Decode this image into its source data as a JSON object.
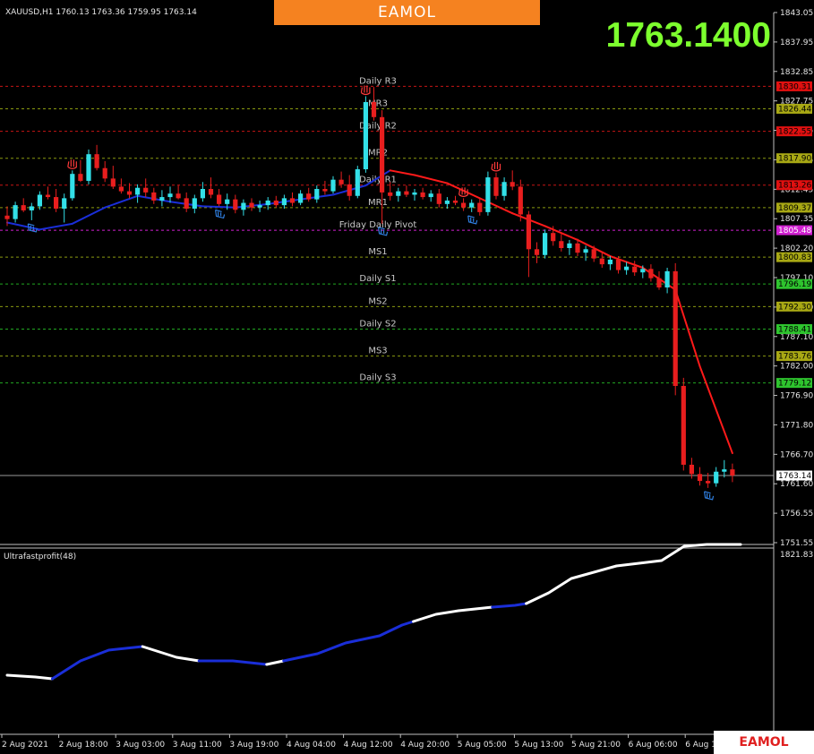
{
  "header": {
    "symbol_line": "XAUUSD,H1  1760.13 1763.36 1759.95 1763.14",
    "big_price": "1763.1400",
    "banner_brand": "EAMOL"
  },
  "footer": {
    "watermark": "EAMOL"
  },
  "indicator": {
    "label": "Ultrafastprofit(48)"
  },
  "colors": {
    "background": "#000000",
    "bull_candle": "#33e0e8",
    "bear_candle": "#e81e1e",
    "ma_up": "#1a2ed8",
    "ma_down": "#ff1a1a",
    "pivot": "#d020d0",
    "resist_tag": "#e01010",
    "mid_tag": "#a8a814",
    "support_tag": "#2ec42e",
    "big_price": "#7dff2e",
    "banner": "#f58220"
  },
  "chart_data": [
    {
      "type": "candlestick",
      "title": "XAUUSD,H1",
      "ylim": [
        1751.55,
        1843.05
      ],
      "y_ticks": [
        "1843.05",
        "1837.95",
        "1832.85",
        "1827.75",
        "1822.65",
        "1817.55",
        "1812.45",
        "1807.35",
        "1802.20",
        "1797.10",
        "1792.00",
        "1787.10",
        "1782.00",
        "1776.90",
        "1771.80",
        "1766.70",
        "1761.60",
        "1756.55",
        "1751.55"
      ],
      "x_ticks": [
        "2 Aug 2021",
        "2 Aug 18:00",
        "3 Aug 03:00",
        "3 Aug 11:00",
        "3 Aug 19:00",
        "4 Aug 04:00",
        "4 Aug 12:00",
        "4 Aug 20:00",
        "5 Aug 05:00",
        "5 Aug 13:00",
        "5 Aug 21:00",
        "6 Aug 06:00",
        "6 Aug 14:00"
      ],
      "current_price": 1763.14,
      "current_price_label": "1763.14",
      "levels": [
        {
          "name": "Daily R3",
          "price": 1830.31,
          "tag": "1830.31",
          "kind": "resist"
        },
        {
          "name": "MR3",
          "price": 1826.44,
          "tag": "1826.44",
          "kind": "mid"
        },
        {
          "name": "Daily R2",
          "price": 1822.55,
          "tag": "1822.55",
          "kind": "resist"
        },
        {
          "name": "MR2",
          "price": 1817.9,
          "tag": "1817.90",
          "kind": "mid"
        },
        {
          "name": "Daily R1",
          "price": 1813.26,
          "tag": "1813.26",
          "kind": "resist"
        },
        {
          "name": "MR1",
          "price": 1809.37,
          "tag": "1809.37",
          "kind": "mid"
        },
        {
          "name": "Friday  Daily Pivot",
          "price": 1805.48,
          "tag": "1805.48",
          "kind": "pivot"
        },
        {
          "name": "MS1",
          "price": 1800.83,
          "tag": "1800.83",
          "kind": "mid"
        },
        {
          "name": "Daily S1",
          "price": 1796.19,
          "tag": "1796.19",
          "kind": "support"
        },
        {
          "name": "MS2",
          "price": 1792.3,
          "tag": "1792.30",
          "kind": "mid"
        },
        {
          "name": "Daily S2",
          "price": 1788.41,
          "tag": "1788.41",
          "kind": "support"
        },
        {
          "name": "MS3",
          "price": 1783.76,
          "tag": "1783.76",
          "kind": "mid"
        },
        {
          "name": "Daily S3",
          "price": 1779.12,
          "tag": "1779.12",
          "kind": "support"
        }
      ],
      "candles": [
        [
          1808.0,
          1809.6,
          1806.2,
          1807.4
        ],
        [
          1807.4,
          1810.4,
          1806.8,
          1809.8
        ],
        [
          1809.8,
          1811.0,
          1808.6,
          1808.9
        ],
        [
          1808.9,
          1810.2,
          1807.2,
          1809.6
        ],
        [
          1809.6,
          1812.2,
          1809.0,
          1811.6
        ],
        [
          1811.6,
          1813.0,
          1810.8,
          1811.2
        ],
        [
          1811.2,
          1812.6,
          1808.6,
          1809.2
        ],
        [
          1809.2,
          1811.8,
          1806.8,
          1811.0
        ],
        [
          1811.0,
          1815.8,
          1810.6,
          1815.2
        ],
        [
          1815.2,
          1817.6,
          1813.8,
          1814.0
        ],
        [
          1814.0,
          1819.4,
          1813.4,
          1818.6
        ],
        [
          1818.6,
          1820.2,
          1815.8,
          1816.2
        ],
        [
          1816.2,
          1817.4,
          1813.8,
          1814.4
        ],
        [
          1814.4,
          1816.6,
          1812.6,
          1813.0
        ],
        [
          1813.0,
          1814.4,
          1811.8,
          1812.2
        ],
        [
          1812.2,
          1813.6,
          1811.0,
          1811.6
        ],
        [
          1811.6,
          1813.4,
          1810.2,
          1812.8
        ],
        [
          1812.8,
          1814.4,
          1811.2,
          1812.0
        ],
        [
          1812.0,
          1812.8,
          1810.0,
          1810.6
        ],
        [
          1810.6,
          1812.4,
          1809.6,
          1811.2
        ],
        [
          1811.2,
          1813.0,
          1810.2,
          1811.8
        ],
        [
          1811.8,
          1813.2,
          1810.8,
          1811.0
        ],
        [
          1811.0,
          1812.0,
          1808.6,
          1809.2
        ],
        [
          1809.2,
          1811.6,
          1808.4,
          1811.0
        ],
        [
          1811.0,
          1813.8,
          1810.4,
          1812.6
        ],
        [
          1812.6,
          1814.6,
          1811.0,
          1811.6
        ],
        [
          1811.6,
          1812.6,
          1809.6,
          1810.0
        ],
        [
          1810.0,
          1811.8,
          1809.0,
          1810.8
        ],
        [
          1810.8,
          1811.6,
          1808.4,
          1809.0
        ],
        [
          1809.0,
          1810.8,
          1808.0,
          1810.2
        ],
        [
          1810.2,
          1811.0,
          1808.8,
          1809.4
        ],
        [
          1809.4,
          1810.6,
          1808.6,
          1809.8
        ],
        [
          1809.8,
          1811.2,
          1809.0,
          1810.6
        ],
        [
          1810.6,
          1811.4,
          1809.4,
          1809.8
        ],
        [
          1809.8,
          1811.6,
          1809.2,
          1811.0
        ],
        [
          1811.0,
          1812.0,
          1809.6,
          1810.2
        ],
        [
          1810.2,
          1812.4,
          1809.8,
          1811.8
        ],
        [
          1811.8,
          1812.8,
          1810.4,
          1810.8
        ],
        [
          1810.8,
          1813.2,
          1810.2,
          1812.6
        ],
        [
          1812.6,
          1814.0,
          1811.6,
          1812.2
        ],
        [
          1812.2,
          1814.8,
          1811.8,
          1814.2
        ],
        [
          1814.2,
          1815.6,
          1812.8,
          1813.4
        ],
        [
          1813.4,
          1815.0,
          1810.6,
          1811.4
        ],
        [
          1811.4,
          1816.6,
          1811.0,
          1816.0
        ],
        [
          1816.0,
          1828.6,
          1815.4,
          1827.6
        ],
        [
          1827.6,
          1830.2,
          1824.4,
          1825.0
        ],
        [
          1825.0,
          1826.2,
          1806.6,
          1812.0
        ],
        [
          1812.0,
          1813.8,
          1810.6,
          1811.4
        ],
        [
          1811.4,
          1812.8,
          1810.4,
          1812.2
        ],
        [
          1812.2,
          1813.2,
          1811.2,
          1811.6
        ],
        [
          1811.6,
          1812.6,
          1810.6,
          1812.0
        ],
        [
          1812.0,
          1812.8,
          1810.8,
          1811.2
        ],
        [
          1811.2,
          1812.4,
          1810.4,
          1811.8
        ],
        [
          1811.8,
          1812.6,
          1809.4,
          1810.0
        ],
        [
          1810.0,
          1811.2,
          1809.2,
          1810.6
        ],
        [
          1810.6,
          1811.4,
          1809.8,
          1810.2
        ],
        [
          1810.2,
          1811.0,
          1808.8,
          1809.4
        ],
        [
          1809.4,
          1810.8,
          1808.6,
          1810.2
        ],
        [
          1810.2,
          1811.0,
          1808.0,
          1808.6
        ],
        [
          1808.6,
          1815.6,
          1808.0,
          1814.6
        ],
        [
          1814.6,
          1815.4,
          1810.8,
          1811.4
        ],
        [
          1811.4,
          1814.6,
          1810.6,
          1813.8
        ],
        [
          1813.8,
          1815.8,
          1812.4,
          1813.0
        ],
        [
          1813.0,
          1814.2,
          1807.0,
          1808.2
        ],
        [
          1808.2,
          1808.8,
          1797.4,
          1802.2
        ],
        [
          1802.2,
          1803.4,
          1799.8,
          1801.2
        ],
        [
          1801.2,
          1805.6,
          1800.6,
          1805.0
        ],
        [
          1805.0,
          1806.2,
          1802.8,
          1803.6
        ],
        [
          1803.6,
          1804.8,
          1801.8,
          1802.4
        ],
        [
          1802.4,
          1803.8,
          1801.2,
          1803.2
        ],
        [
          1803.2,
          1804.0,
          1801.0,
          1801.6
        ],
        [
          1801.6,
          1802.8,
          1800.2,
          1802.2
        ],
        [
          1802.2,
          1802.8,
          1800.0,
          1800.6
        ],
        [
          1800.6,
          1801.6,
          1799.0,
          1799.6
        ],
        [
          1799.6,
          1801.0,
          1798.6,
          1800.4
        ],
        [
          1800.4,
          1801.0,
          1798.0,
          1798.6
        ],
        [
          1798.6,
          1800.0,
          1797.8,
          1799.2
        ],
        [
          1799.2,
          1800.2,
          1797.6,
          1798.2
        ],
        [
          1798.2,
          1799.4,
          1797.2,
          1798.8
        ],
        [
          1798.8,
          1799.6,
          1796.6,
          1797.2
        ],
        [
          1797.2,
          1798.4,
          1795.2,
          1795.6
        ],
        [
          1795.6,
          1799.0,
          1794.6,
          1798.4
        ],
        [
          1798.4,
          1799.8,
          1777.0,
          1778.6
        ],
        [
          1778.6,
          1780.0,
          1764.0,
          1765.0
        ],
        [
          1765.0,
          1766.2,
          1762.6,
          1763.4
        ],
        [
          1763.4,
          1764.6,
          1761.4,
          1762.2
        ],
        [
          1762.2,
          1763.6,
          1761.0,
          1761.8
        ],
        [
          1761.8,
          1764.6,
          1761.2,
          1763.8
        ],
        [
          1763.8,
          1765.8,
          1762.8,
          1764.2
        ],
        [
          1764.2,
          1765.2,
          1762.0,
          1763.14
        ]
      ],
      "ma_points": [
        [
          0,
          1806.8
        ],
        [
          4,
          1805.6
        ],
        [
          8,
          1806.6
        ],
        [
          12,
          1809.4
        ],
        [
          16,
          1811.4
        ],
        [
          20,
          1810.4
        ],
        [
          24,
          1809.6
        ],
        [
          28,
          1809.4
        ],
        [
          32,
          1810.0
        ],
        [
          36,
          1810.8
        ],
        [
          40,
          1811.6
        ],
        [
          44,
          1813.2
        ],
        [
          47,
          1815.8
        ],
        [
          50,
          1815.0
        ],
        [
          54,
          1813.6
        ],
        [
          58,
          1811.0
        ],
        [
          62,
          1808.4
        ],
        [
          66,
          1806.2
        ],
        [
          70,
          1803.8
        ],
        [
          74,
          1801.0
        ],
        [
          78,
          1799.0
        ],
        [
          82,
          1795.2
        ],
        [
          85,
          1782.0
        ],
        [
          89,
          1767.0
        ]
      ],
      "ma_color_switches": [
        [
          0,
          "up"
        ],
        [
          47,
          "down"
        ]
      ],
      "markers": [
        {
          "at": 8,
          "kind": "sell"
        },
        {
          "at": 44,
          "kind": "sell"
        },
        {
          "at": 56,
          "kind": "sell"
        },
        {
          "at": 60,
          "kind": "sell"
        },
        {
          "at": 3,
          "kind": "buy"
        },
        {
          "at": 26,
          "kind": "buy"
        },
        {
          "at": 46,
          "kind": "buy"
        },
        {
          "at": 57,
          "kind": "buy"
        },
        {
          "at": 86,
          "kind": "buy"
        }
      ]
    },
    {
      "type": "line",
      "title": "Ultrafastprofit(48)",
      "y_ticks": [
        "1821.837"
      ],
      "segments": [
        {
          "color": "white",
          "points": [
            [
              0,
              0.68
            ],
            [
              5,
              0.69
            ],
            [
              8,
              0.7
            ]
          ]
        },
        {
          "color": "blue",
          "points": [
            [
              8,
              0.7
            ],
            [
              13,
              0.6
            ],
            [
              18,
              0.54
            ],
            [
              24,
              0.52
            ]
          ]
        },
        {
          "color": "white",
          "points": [
            [
              24,
              0.52
            ],
            [
              30,
              0.58
            ],
            [
              34,
              0.6
            ]
          ]
        },
        {
          "color": "blue",
          "points": [
            [
              34,
              0.6
            ],
            [
              40,
              0.6
            ],
            [
              46,
              0.62
            ]
          ]
        },
        {
          "color": "white",
          "points": [
            [
              46,
              0.62
            ],
            [
              49,
              0.6
            ]
          ]
        },
        {
          "color": "blue",
          "points": [
            [
              49,
              0.6
            ],
            [
              55,
              0.56
            ],
            [
              60,
              0.5
            ],
            [
              66,
              0.46
            ],
            [
              70,
              0.4
            ],
            [
              72,
              0.38
            ]
          ]
        },
        {
          "color": "white",
          "points": [
            [
              72,
              0.38
            ],
            [
              76,
              0.34
            ],
            [
              80,
              0.32
            ],
            [
              86,
              0.3
            ]
          ]
        },
        {
          "color": "blue",
          "points": [
            [
              86,
              0.3
            ],
            [
              90,
              0.29
            ],
            [
              92,
              0.28
            ]
          ]
        },
        {
          "color": "white",
          "points": [
            [
              92,
              0.28
            ],
            [
              96,
              0.22
            ],
            [
              100,
              0.14
            ],
            [
              108,
              0.07
            ],
            [
              116,
              0.04
            ],
            [
              120,
              -0.04
            ],
            [
              124,
              -0.3
            ],
            [
              128,
              -0.85
            ],
            [
              130,
              -1.0
            ]
          ]
        }
      ]
    }
  ]
}
